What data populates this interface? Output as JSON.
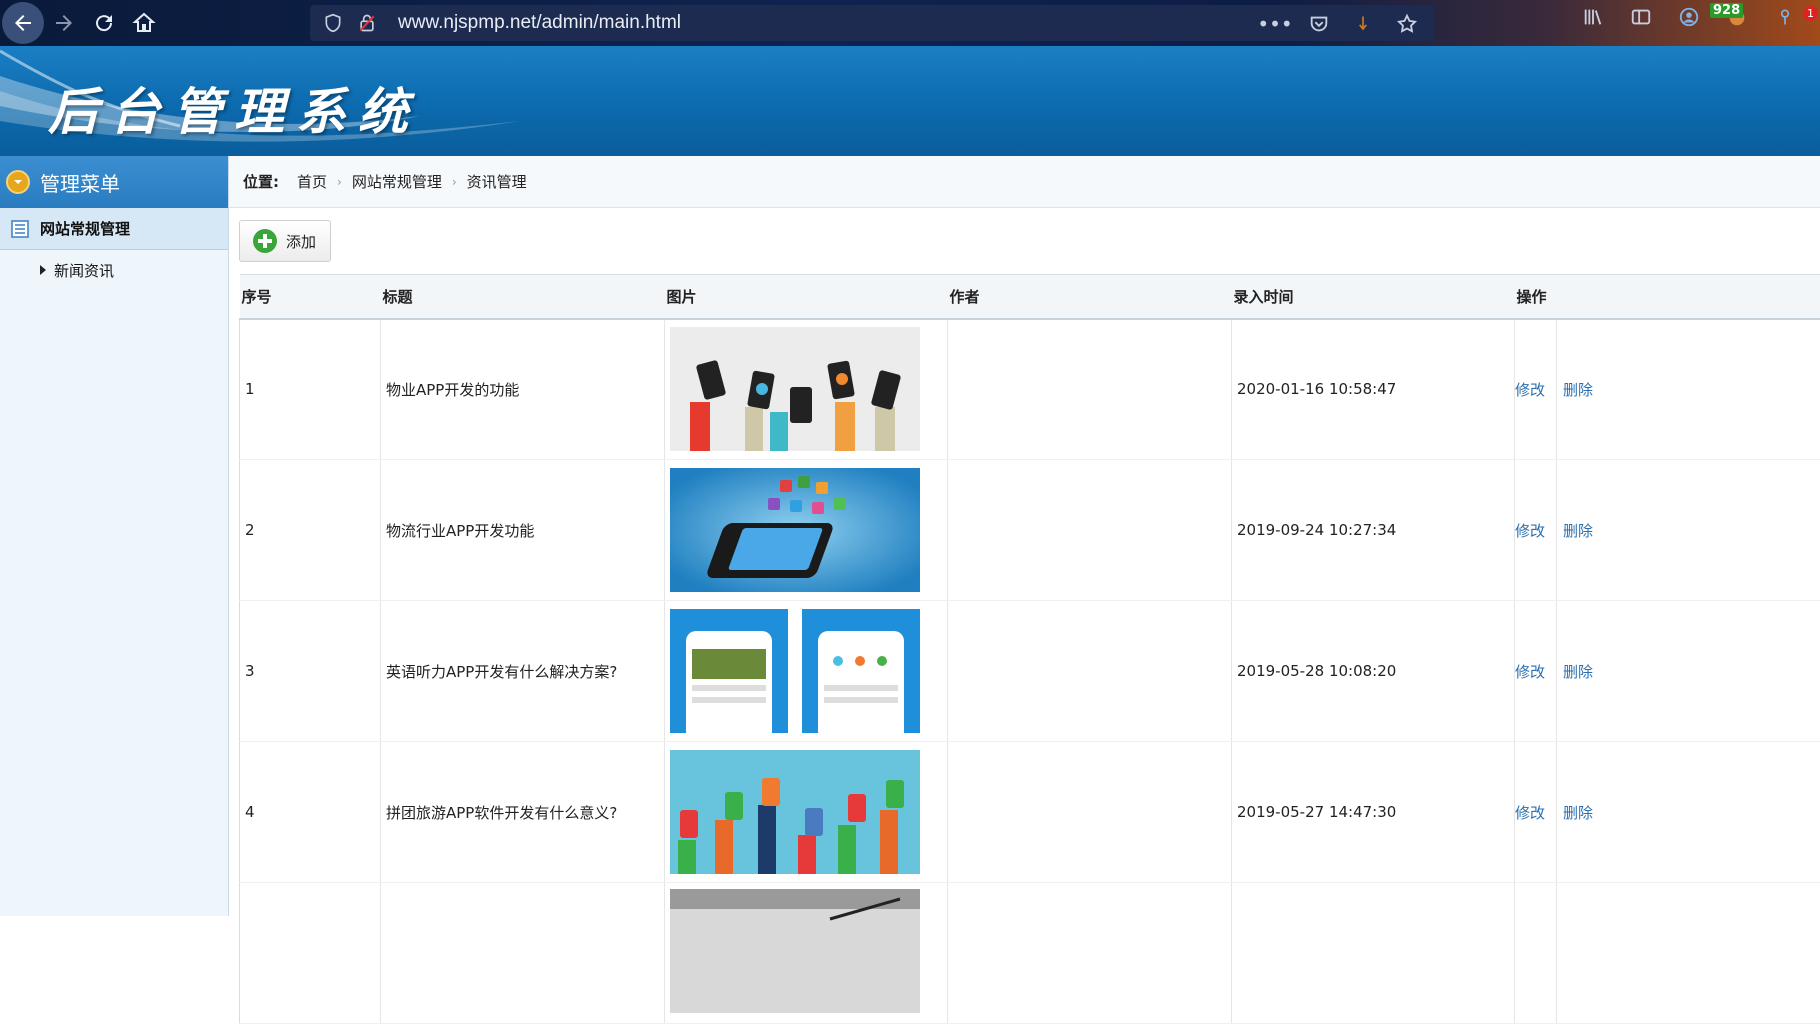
{
  "browser": {
    "url": "www.njspmp.net/admin/main.html",
    "badge_count": "928",
    "alert_count": "1"
  },
  "banner": {
    "title": "后台管理系统"
  },
  "sidebar": {
    "header": "管理菜单",
    "group": "网站常规管理",
    "items": [
      {
        "label": "新闻资讯"
      }
    ]
  },
  "breadcrumb": {
    "label": "位置:",
    "crumbs": [
      "首页",
      "网站常规管理",
      "资讯管理"
    ]
  },
  "toolbar": {
    "add_label": "添加"
  },
  "table": {
    "headers": [
      "序号",
      "标题",
      "图片",
      "作者",
      "录入时间",
      "操作"
    ],
    "rows": [
      {
        "id": "1",
        "title": "物业APP开发的功能",
        "image": "hands-phones-gray",
        "author": "",
        "time": "2020-01-16 10:58:47",
        "edit": "修改",
        "delete": "删除"
      },
      {
        "id": "2",
        "title": "物流行业APP开发功能",
        "image": "phone-app-icons-blue",
        "author": "",
        "time": "2019-09-24 10:27:34",
        "edit": "修改",
        "delete": "删除"
      },
      {
        "id": "3",
        "title": "英语听力APP开发有什么解决方案?",
        "image": "two-phone-screens-blue",
        "author": "",
        "time": "2019-05-28 10:08:20",
        "edit": "修改",
        "delete": "删除"
      },
      {
        "id": "4",
        "title": "拼团旅游APP软件开发有什么意义?",
        "image": "hands-phones-lightblue",
        "author": "",
        "time": "2019-05-27 14:47:30",
        "edit": "修改",
        "delete": "删除"
      }
    ]
  },
  "colors": {
    "banner": "#0c6aae",
    "sidebar_header": "#2a7cc0",
    "link": "#2a6fb0"
  }
}
